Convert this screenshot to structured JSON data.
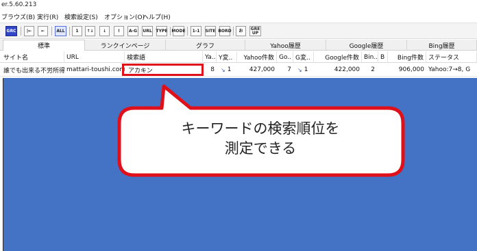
{
  "window": {
    "title": "er.5.60.213"
  },
  "menu": [
    {
      "label": "ブラウズ(B)"
    },
    {
      "label": "実行(R)"
    },
    {
      "label": "検索設定(S)"
    },
    {
      "label": "オプション(O)"
    },
    {
      "label": "ヘルプ(H)"
    }
  ],
  "toolbar": {
    "buttons": [
      {
        "label": "GRC",
        "icon": "grc-logo-icon"
      },
      {
        "label": "|←",
        "icon": "first-icon"
      },
      {
        "label": "←",
        "icon": "back-icon"
      },
      {
        "label": "ALL",
        "icon": "all-icon"
      },
      {
        "label": "1",
        "icon": "up-icon"
      },
      {
        "label": "↑↓",
        "icon": "sort-icon"
      },
      {
        "label": "↓",
        "icon": "down-icon"
      },
      {
        "label": "!",
        "icon": "alert-icon"
      },
      {
        "label": "A-G",
        "icon": "a-g-icon"
      },
      {
        "label": "URL",
        "icon": "url-icon"
      },
      {
        "label": "TYPE",
        "icon": "type-icon"
      },
      {
        "label": "MODE",
        "icon": "mode-icon"
      },
      {
        "label": "1-1",
        "icon": "range-icon"
      },
      {
        "label": "SITE",
        "icon": "site-icon"
      },
      {
        "label": "BORD",
        "icon": "border-icon"
      },
      {
        "label": "お",
        "icon": "fav-icon"
      },
      {
        "label": "GRE UP",
        "icon": "gre-up-icon"
      }
    ]
  },
  "tabs": [
    {
      "label": "標準"
    },
    {
      "label": "ランクインページ"
    },
    {
      "label": "グラフ"
    },
    {
      "label": "Yahoo履歴"
    },
    {
      "label": "Google履歴"
    },
    {
      "label": "Bing履歴"
    }
  ],
  "table": {
    "columns": [
      {
        "label": "サイト名"
      },
      {
        "label": "URL"
      },
      {
        "label": "検索語"
      },
      {
        "label": "Ya.."
      },
      {
        "label": "Y変.."
      },
      {
        "label": "Yahoo件数"
      },
      {
        "label": "Go.."
      },
      {
        "label": "G変.."
      },
      {
        "label": "Google件数"
      },
      {
        "label": "Bin.."
      },
      {
        "label": "B"
      },
      {
        "label": "Bing件数"
      },
      {
        "label": "ステータス"
      }
    ],
    "rows": [
      {
        "site": "誰でも出来る不労所得",
        "url": "mattari-toushi.com",
        "keyword": "アカキン",
        "yahoo_rank": "8",
        "yahoo_change_icon": "down-right-arrow-icon",
        "yahoo_change": "1",
        "yahoo_count": "427,000",
        "google_rank": "7",
        "google_change_icon": "down-right-arrow-icon",
        "google_change": "1",
        "google_count": "422,000",
        "bing_rank": "2",
        "bing_change": "",
        "bing_count": "906,000",
        "status": "Yahoo:7→8, G"
      }
    ]
  },
  "callout": {
    "line1": "キーワードの検索順位を",
    "line2": "測定できる"
  },
  "colors": {
    "canvas": "#4472c4",
    "highlight": "#e0101a",
    "callout_border": "#e0101a",
    "callout_fill": "#ffffff"
  }
}
